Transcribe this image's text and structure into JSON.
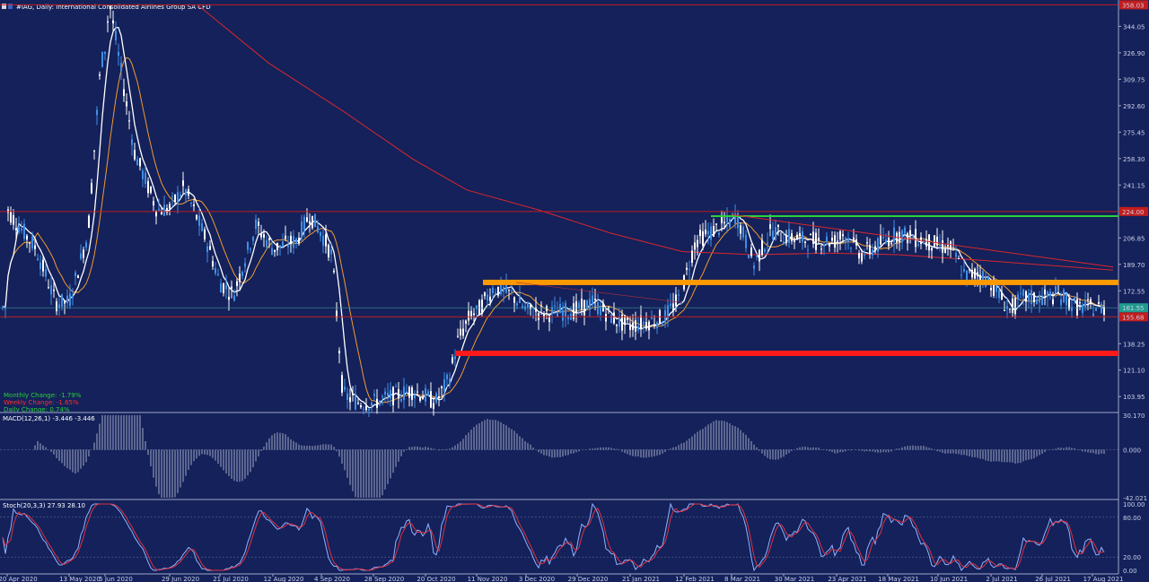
{
  "window": {
    "title": "#IAG, Daily: International Consolidated Airlines Group SA CFD"
  },
  "colors": {
    "background": "#14215a",
    "bull_candle": "#3f8fe6",
    "bear_candle": "#ffffff",
    "sma_fast": "#ffffff",
    "sma_slow": "#f29a2e",
    "sma_long": "#d9262e",
    "resistance_green": "#2cd13a",
    "resistance_orange": "#ff9900",
    "support_red": "#ff1a1a",
    "price_badge": "#1f9b8d",
    "hline_badge": "#c21d1d"
  },
  "info_panel": {
    "monthly": "Monthly Change: -1.79%",
    "weekly": "Weekly Change: -1.65%",
    "daily": "Daily Change: 0.74%"
  },
  "price_axis": {
    "labels": [
      "344.05",
      "326.90",
      "309.75",
      "292.60",
      "275.45",
      "258.30",
      "241.15",
      "206.85",
      "189.70",
      "172.55",
      "138.25",
      "121.10",
      "103.95"
    ],
    "min": 94.2,
    "max": 360.0,
    "current_price": 161.55,
    "current_price_label": "161.55",
    "hline_upper_label": "358.03",
    "hline_mid_label": "224.00",
    "hline_lower_label": "155.68"
  },
  "time_axis": {
    "labels": [
      "20 Apr 2020",
      "13 May 2020",
      "5 Jun 2020",
      "29 Jun 2020",
      "21 Jul 2020",
      "12 Aug 2020",
      "4 Sep 2020",
      "28 Sep 2020",
      "20 Oct 2020",
      "11 Nov 2020",
      "3 Dec 2020",
      "29 Dec 2020",
      "21 Jan 2021",
      "12 Feb 2021",
      "8 Mar 2021",
      "30 Mar 2021",
      "23 Apr 2021",
      "18 May 2021",
      "10 Jun 2021",
      "2 Jul 2021",
      "26 Jul 2021",
      "17 Aug 2021"
    ]
  },
  "macd": {
    "label": "MACD(12,26,1) -3.446 -3.446",
    "axis_labels": [
      "30.170",
      "0.000",
      "-42.021"
    ],
    "max": 30.17,
    "min": -42.021
  },
  "stoch": {
    "label": "Stoch(20,3,3) 27.93 28.10",
    "axis_labels": [
      "100.00",
      "80.00",
      "20.00",
      "0.00"
    ]
  },
  "chart_data": {
    "type": "candlestick",
    "title": "#IAG, Daily: International Consolidated Airlines Group SA CFD",
    "price_series_approx_close": [
      {
        "x": "20 Apr 2020",
        "y": 225
      },
      {
        "x": "13 May 2020",
        "y": 165
      },
      {
        "x": "5 Jun 2020",
        "y": 330
      },
      {
        "x": "29 Jun 2020",
        "y": 226
      },
      {
        "x": "21 Jul 2020",
        "y": 178
      },
      {
        "x": "12 Aug 2020",
        "y": 200
      },
      {
        "x": "4 Sep 2020",
        "y": 210
      },
      {
        "x": "28 Sep 2020",
        "y": 100
      },
      {
        "x": "20 Oct 2020",
        "y": 104
      },
      {
        "x": "11 Nov 2020",
        "y": 158
      },
      {
        "x": "3 Dec 2020",
        "y": 160
      },
      {
        "x": "29 Dec 2020",
        "y": 160
      },
      {
        "x": "21 Jan 2021",
        "y": 150
      },
      {
        "x": "12 Feb 2021",
        "y": 178
      },
      {
        "x": "8 Mar 2021",
        "y": 218
      },
      {
        "x": "30 Mar 2021",
        "y": 208
      },
      {
        "x": "23 Apr 2021",
        "y": 205
      },
      {
        "x": "18 May 2021",
        "y": 206
      },
      {
        "x": "10 Jun 2021",
        "y": 202
      },
      {
        "x": "2 Jul 2021",
        "y": 178
      },
      {
        "x": "26 Jul 2021",
        "y": 168
      },
      {
        "x": "17 Aug 2021",
        "y": 161.55
      }
    ],
    "horizontal_levels": [
      {
        "name": "green resistance",
        "value": 221,
        "color": "#2cd13a"
      },
      {
        "name": "orange zone",
        "value": 178,
        "color": "#ff9900"
      },
      {
        "name": "red support",
        "value": 132,
        "color": "#ff1a1a"
      },
      {
        "name": "upper line",
        "value": 358.03,
        "color": "#c21d1d"
      },
      {
        "name": "mid line",
        "value": 224.0,
        "color": "#c21d1d"
      },
      {
        "name": "lower line",
        "value": 155.68,
        "color": "#c21d1d"
      }
    ],
    "ylim": [
      94.2,
      360.0
    ]
  }
}
